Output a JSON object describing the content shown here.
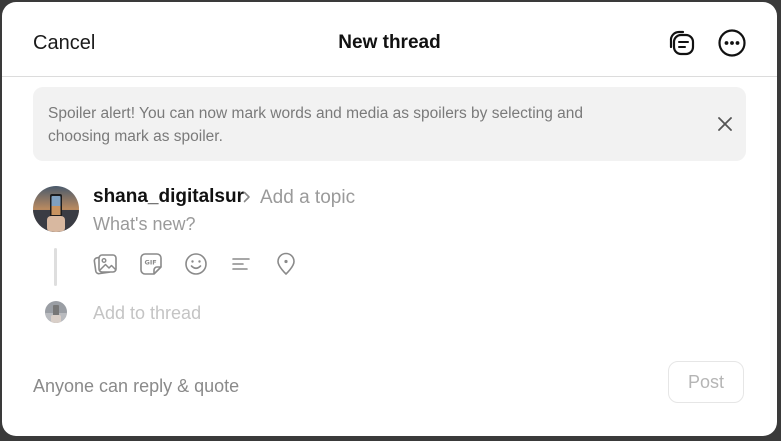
{
  "header": {
    "cancel_label": "Cancel",
    "title": "New thread",
    "drafts_icon": "drafts-icon",
    "more_icon": "more-options-icon"
  },
  "banner": {
    "text": "Spoiler alert! You can now mark words and media as spoilers by selecting and choosing mark as spoiler.",
    "close_icon": "close-icon"
  },
  "composer": {
    "username": "shana_digitalsur",
    "topic_placeholder": "Add a topic",
    "placeholder": "What's new?",
    "tools": [
      "image-icon",
      "gif-icon",
      "emoji-icon",
      "poll-icon",
      "location-icon"
    ],
    "add_to_thread": "Add to thread"
  },
  "footer": {
    "reply_setting": "Anyone can reply & quote",
    "post_label": "Post"
  },
  "colors": {
    "accent_text": "#111111",
    "muted_text": "#9a9a9a",
    "banner_bg": "#f2f2f2"
  }
}
